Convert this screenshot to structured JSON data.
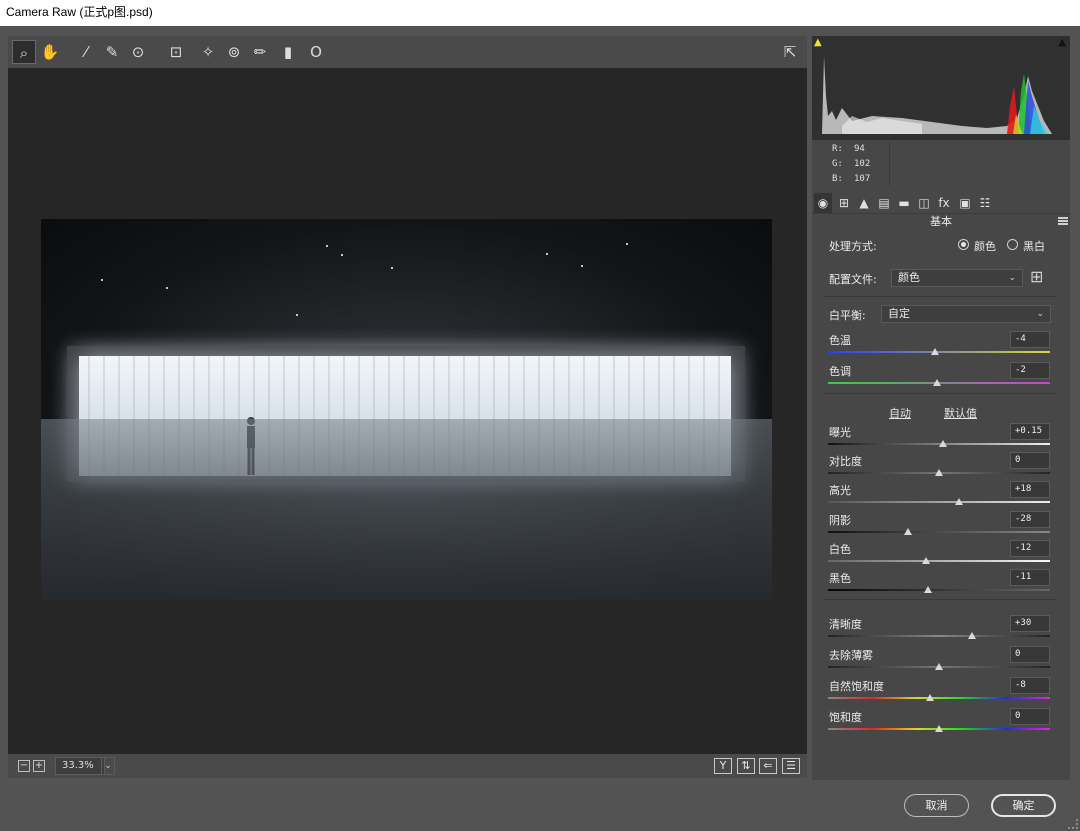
{
  "window": {
    "title": "Camera Raw (正式p图.psd)"
  },
  "toolbar": {
    "tools": [
      {
        "name": "zoom-tool",
        "glyph": "⌕"
      },
      {
        "name": "hand-tool",
        "glyph": "✋"
      },
      {
        "name": "white-balance-tool",
        "glyph": "⁄"
      },
      {
        "name": "color-sampler-tool",
        "glyph": "✎"
      },
      {
        "name": "targeted-adjustment-tool",
        "glyph": "⊙"
      },
      {
        "name": "crop-tool",
        "glyph": "⊡"
      },
      {
        "name": "spot-removal-tool",
        "glyph": "✧"
      },
      {
        "name": "red-eye-tool",
        "glyph": "⊚"
      },
      {
        "name": "adjustment-brush-tool",
        "glyph": "✏"
      },
      {
        "name": "graduated-filter-tool",
        "glyph": "▮"
      },
      {
        "name": "radial-filter-tool",
        "glyph": "O"
      }
    ],
    "fullscreen_glyph": "⇱"
  },
  "status": {
    "zoom_out": "−",
    "zoom_in": "+",
    "zoom_value": "33.3%",
    "zoom_dropdown": "⌄",
    "icons": [
      {
        "name": "before-after-view-icon",
        "glyph": "Y"
      },
      {
        "name": "swap-settings-icon",
        "glyph": "⇅"
      },
      {
        "name": "copy-settings-icon",
        "glyph": "⇐"
      },
      {
        "name": "view-settings-icon",
        "glyph": "☰"
      }
    ]
  },
  "histogram": {
    "shadow_clip_glyph": "▲",
    "highlight_clip_glyph": "▲"
  },
  "readout": {
    "r_label": "R:",
    "r_value": "94",
    "g_label": "G:",
    "g_value": "102",
    "b_label": "B:",
    "b_value": "107"
  },
  "tabs": [
    {
      "name": "tab-basic",
      "glyph": "◉"
    },
    {
      "name": "tab-tone-curve",
      "glyph": "⊞"
    },
    {
      "name": "tab-detail",
      "glyph": "▲"
    },
    {
      "name": "tab-hsl",
      "glyph": "▤"
    },
    {
      "name": "tab-split-toning",
      "glyph": "▬"
    },
    {
      "name": "tab-lens",
      "glyph": "◫"
    },
    {
      "name": "tab-effects",
      "glyph": "fx"
    },
    {
      "name": "tab-calibration",
      "glyph": "▣"
    },
    {
      "name": "tab-presets",
      "glyph": "☷"
    }
  ],
  "panel": {
    "title": "基本",
    "treatment_label": "处理方式:",
    "treatment_color": "颜色",
    "treatment_bw": "黑白",
    "profile_label": "配置文件:",
    "profile_value": "颜色",
    "profile_grid_glyph": "⊞",
    "wb_label": "白平衡:",
    "wb_value": "自定",
    "auto_link": "自动",
    "default_link": "默认值"
  },
  "sliders": [
    {
      "name": "temperature",
      "label": "色温",
      "value": "-4",
      "pos": 0.48,
      "gradient": "linear-gradient(90deg,#2a3cff,#d8d840)"
    },
    {
      "name": "tint",
      "label": "色调",
      "value": "-2",
      "pos": 0.49,
      "gradient": "linear-gradient(90deg,#2ad83a,#d83ad8)"
    },
    {
      "name": "exposure",
      "label": "曝光",
      "value": "+0.15",
      "pos": 0.52,
      "gradient": "linear-gradient(90deg,#111,#f0f0f0)"
    },
    {
      "name": "contrast",
      "label": "对比度",
      "value": "0",
      "pos": 0.5,
      "gradient": "linear-gradient(90deg,#222,#777,#222)"
    },
    {
      "name": "highlights",
      "label": "高光",
      "value": "+18",
      "pos": 0.59,
      "gradient": "linear-gradient(90deg,#555,#eee)"
    },
    {
      "name": "shadows",
      "label": "阴影",
      "value": "-28",
      "pos": 0.36,
      "gradient": "linear-gradient(90deg,#111,#888)"
    },
    {
      "name": "whites",
      "label": "白色",
      "value": "-12",
      "pos": 0.44,
      "gradient": "linear-gradient(90deg,#666,#fafafa)"
    },
    {
      "name": "blacks",
      "label": "黑色",
      "value": "-11",
      "pos": 0.45,
      "gradient": "linear-gradient(90deg,#050505,#666)"
    },
    {
      "name": "clarity",
      "label": "清晰度",
      "value": "+30",
      "pos": 0.65,
      "gradient": "linear-gradient(90deg,#222,#888,#222)"
    },
    {
      "name": "dehaze",
      "label": "去除薄雾",
      "value": "0",
      "pos": 0.5,
      "gradient": "linear-gradient(90deg,#222,#777,#222)"
    },
    {
      "name": "vibrance",
      "label": "自然饱和度",
      "value": "-8",
      "pos": 0.46,
      "gradient": "linear-gradient(90deg,#888,#d82a2a,#d8d82a,#2ad82a,#2a2ad8,#d82ad8)"
    },
    {
      "name": "saturation",
      "label": "饱和度",
      "value": "0",
      "pos": 0.5,
      "gradient": "linear-gradient(90deg,#888,#d82a2a,#d8d82a,#2ad82a,#2a2ad8,#d82ad8)"
    }
  ],
  "buttons": {
    "cancel": "取消",
    "ok": "确定"
  }
}
